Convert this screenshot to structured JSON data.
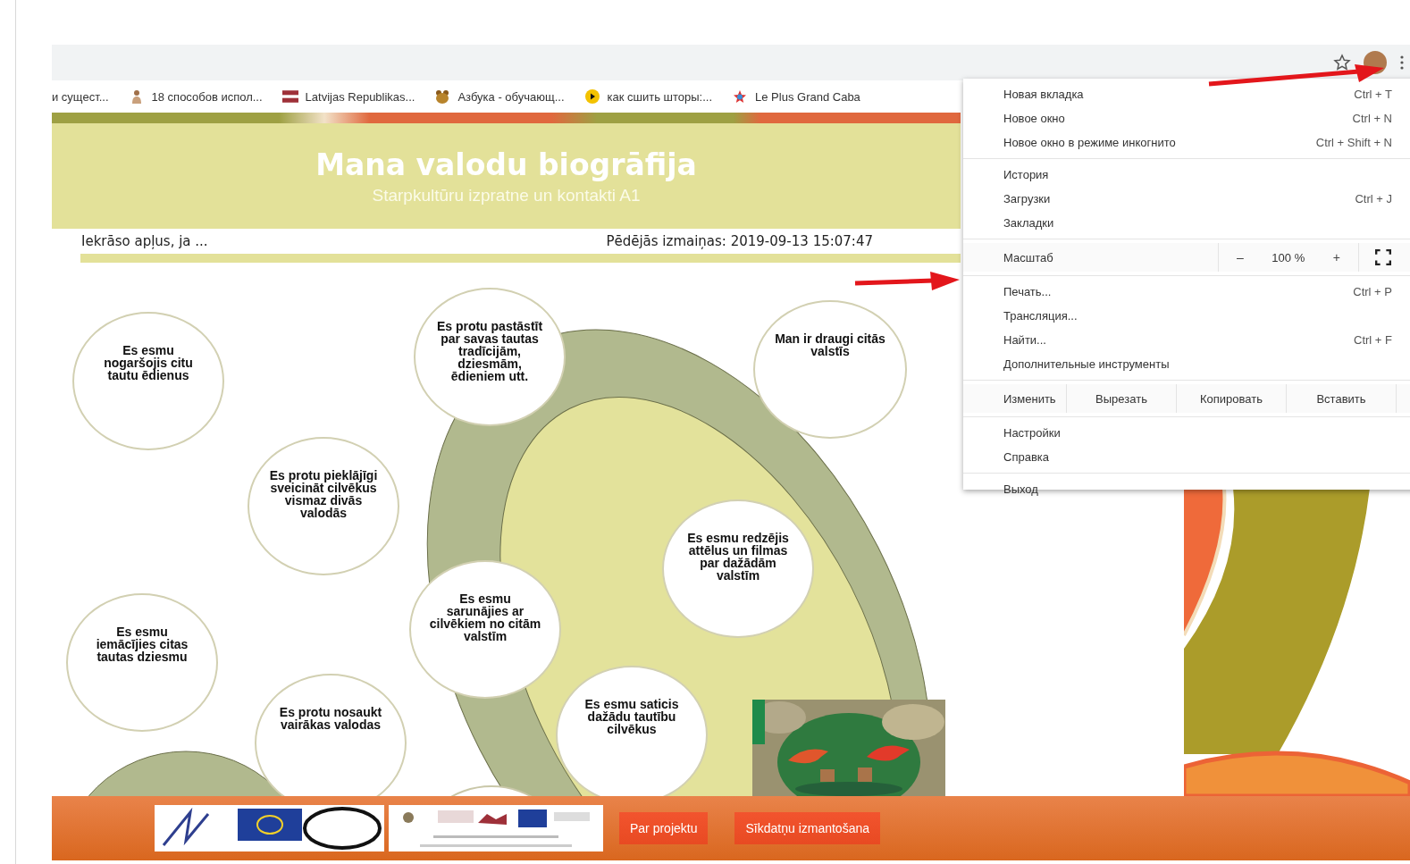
{
  "bookmarks": [
    {
      "label": "и сущест..."
    },
    {
      "label": "18 способов испол..."
    },
    {
      "label": "Latvijas Republikas..."
    },
    {
      "label": "Азбука - обучающ..."
    },
    {
      "label": "как сшить шторы:..."
    },
    {
      "label": "Le Plus Grand Caba"
    }
  ],
  "header": {
    "title": "Mana valodu biogrāfija",
    "subtitle": "Starpkultūru izpratne un kontakti A1"
  },
  "info": {
    "instruction": "Iekrāso apļus, ja ...",
    "last_modified": "Pēdējās izmaiņas: 2019-09-13 15:07:47"
  },
  "circles": [
    {
      "text": "Es esmu nogaršojis citu tautu ēdienus"
    },
    {
      "text": "Es protu pastāstīt par savas tautas tradīcijām, dziesmām, ēdieniem utt."
    },
    {
      "text": "Man ir draugi citās valstīs"
    },
    {
      "text": "Es protu pieklājīgi sveicināt cilvēkus vismaz divās valodās"
    },
    {
      "text": "Es esmu redzējis attēlus un filmas par dažādām valstīm"
    },
    {
      "text": "Es esmu sarunājies ar cilvēkiem no citām valstīm"
    },
    {
      "text": "Es esmu iemācījies citas tautas dziesmu"
    },
    {
      "text": "Es protu nosaukt vairākas valodas"
    },
    {
      "text": "Es esmu saticis dažādu tautību cilvēkus"
    }
  ],
  "footer": {
    "buttons": [
      "Par projektu",
      "Sīkdatņu izmantošana"
    ]
  },
  "menu": [
    {
      "kind": "item",
      "label": "Новая вкладка",
      "shortcut": "Ctrl + T"
    },
    {
      "kind": "item",
      "label": "Новое окно",
      "shortcut": "Ctrl + N"
    },
    {
      "kind": "item",
      "label": "Новое окно в режиме инкогнито",
      "shortcut": "Ctrl + Shift + N"
    },
    {
      "kind": "separator"
    },
    {
      "kind": "item",
      "label": "История"
    },
    {
      "kind": "item",
      "label": "Загрузки",
      "shortcut": "Ctrl + J"
    },
    {
      "kind": "item",
      "label": "Закладки"
    },
    {
      "kind": "separator"
    },
    {
      "kind": "zoom",
      "label": "Масштаб",
      "minus": "–",
      "value": "100 %",
      "plus": "+"
    },
    {
      "kind": "separator"
    },
    {
      "kind": "item",
      "label": "Печать...",
      "shortcut": "Ctrl + P"
    },
    {
      "kind": "item",
      "label": "Трансляция..."
    },
    {
      "kind": "item",
      "label": "Найти...",
      "shortcut": "Ctrl + F"
    },
    {
      "kind": "item",
      "label": "Дополнительные инструменты"
    },
    {
      "kind": "separator"
    },
    {
      "kind": "edit",
      "label": "Изменить",
      "actions": [
        "Вырезать",
        "Копировать",
        "Вставить"
      ]
    },
    {
      "kind": "separator"
    },
    {
      "kind": "item",
      "label": "Настройки"
    },
    {
      "kind": "item",
      "label": "Справка"
    },
    {
      "kind": "separator"
    },
    {
      "kind": "item",
      "label": "Выход"
    }
  ]
}
